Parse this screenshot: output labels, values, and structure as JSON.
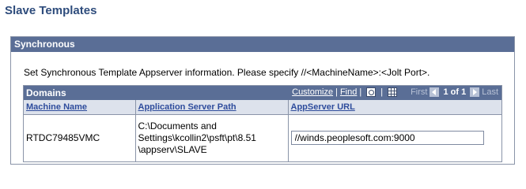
{
  "page": {
    "title": "Slave Templates"
  },
  "group": {
    "title": "Synchronous",
    "instruction": "Set Synchronous Template Appserver information. Please specify //<MachineName>:<Jolt Port>."
  },
  "grid": {
    "title": "Domains",
    "customize_label": "Customize",
    "find_label": "Find",
    "separator": "|",
    "first_label": "First",
    "page_count": "1 of 1",
    "last_label": "Last",
    "zoom_icon": "view-all-icon",
    "download_icon": "download-grid-icon",
    "columns": [
      "Machine Name",
      "Application Server Path",
      "AppServer URL"
    ],
    "rows": [
      {
        "machine_name": "RTDC79485VMC",
        "server_path": "C:\\Documents and\nSettings\\kcollin2\\psft\\pt\\8.51\n\\appserv\\SLAVE",
        "appserver_url": "//winds.peoplesoft.com:9000"
      }
    ]
  },
  "colors": {
    "header_bg": "#5a6e96",
    "title_text": "#2e4c7c",
    "column_header_bg": "#dde2ec",
    "link": "#2e4c9c"
  }
}
